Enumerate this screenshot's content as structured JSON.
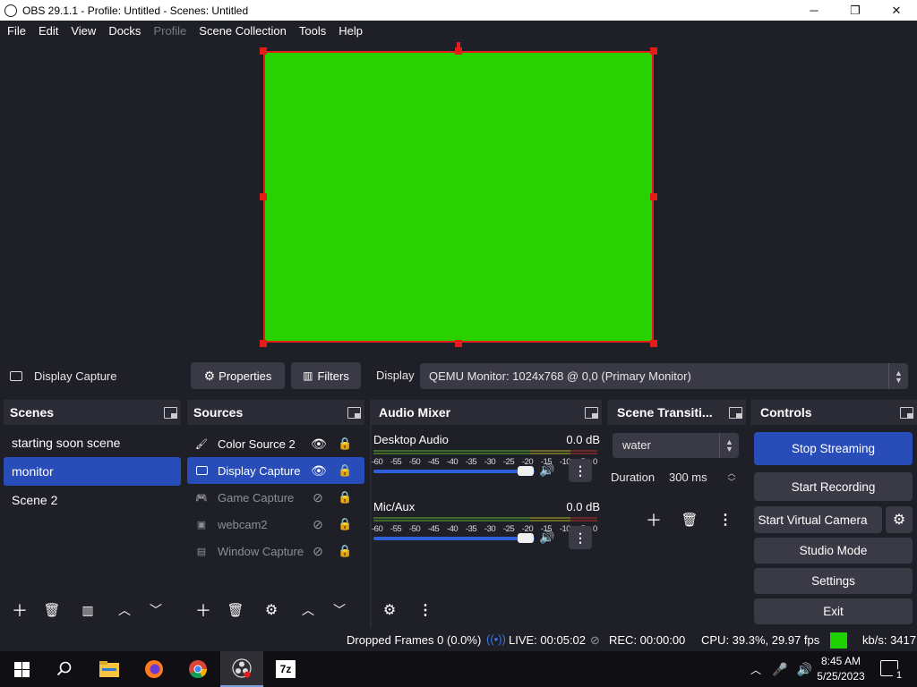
{
  "window": {
    "title": "OBS 29.1.1 - Profile: Untitled - Scenes: Untitled",
    "minimize": "─",
    "maximize": "❐",
    "close": "✕"
  },
  "menu": [
    "File",
    "Edit",
    "View",
    "Docks",
    "Profile",
    "Scene Collection",
    "Tools",
    "Help"
  ],
  "context_bar": {
    "source_name": "Display Capture",
    "properties_label": "Properties",
    "filters_label": "Filters",
    "display_label": "Display",
    "display_value": "QEMU Monitor: 1024x768 @ 0,0 (Primary Monitor)"
  },
  "scenes": {
    "title": "Scenes",
    "items": [
      "starting soon scene",
      "monitor",
      "Scene 2"
    ],
    "selected": "monitor"
  },
  "sources": {
    "title": "Sources",
    "items": [
      {
        "name": "Color Source 2",
        "icon": "brush-icon",
        "visible": true
      },
      {
        "name": "Display Capture",
        "icon": "monitor-icon",
        "visible": true
      },
      {
        "name": "Game Capture",
        "icon": "gamepad-icon",
        "visible": false
      },
      {
        "name": "webcam2",
        "icon": "image-icon",
        "visible": false
      },
      {
        "name": "Window Capture",
        "icon": "window-icon",
        "visible": false
      }
    ]
  },
  "audio_mixer": {
    "title": "Audio Mixer",
    "channels": [
      {
        "name": "Desktop Audio",
        "db": "0.0 dB"
      },
      {
        "name": "Mic/Aux",
        "db": "0.0 dB"
      }
    ],
    "ticks": [
      "-60",
      "-55",
      "-50",
      "-45",
      "-40",
      "-35",
      "-30",
      "-25",
      "-20",
      "-15",
      "-10",
      "-5",
      "0"
    ]
  },
  "transitions": {
    "title": "Scene Transiti...",
    "selected": "water",
    "duration_label": "Duration",
    "duration_value": "300 ms"
  },
  "controls": {
    "title": "Controls",
    "stop_streaming": "Stop Streaming",
    "start_recording": "Start Recording",
    "start_virtual_camera": "Start Virtual Camera",
    "studio_mode": "Studio Mode",
    "settings": "Settings",
    "exit": "Exit"
  },
  "status": {
    "dropped_frames": "Dropped Frames 0 (0.0%)",
    "live": "LIVE: 00:05:02",
    "rec": "REC: 00:00:00",
    "cpu": "CPU: 39.3%, 29.97 fps",
    "kbs": "kb/s: 3417"
  },
  "taskbar": {
    "time": "8:45 AM",
    "date": "5/25/2023",
    "notifications": "1"
  },
  "colors": {
    "accent": "#284cb8",
    "canvas_fill": "#2ad100",
    "selection": "#e51c1c",
    "health": "#1ed000"
  }
}
